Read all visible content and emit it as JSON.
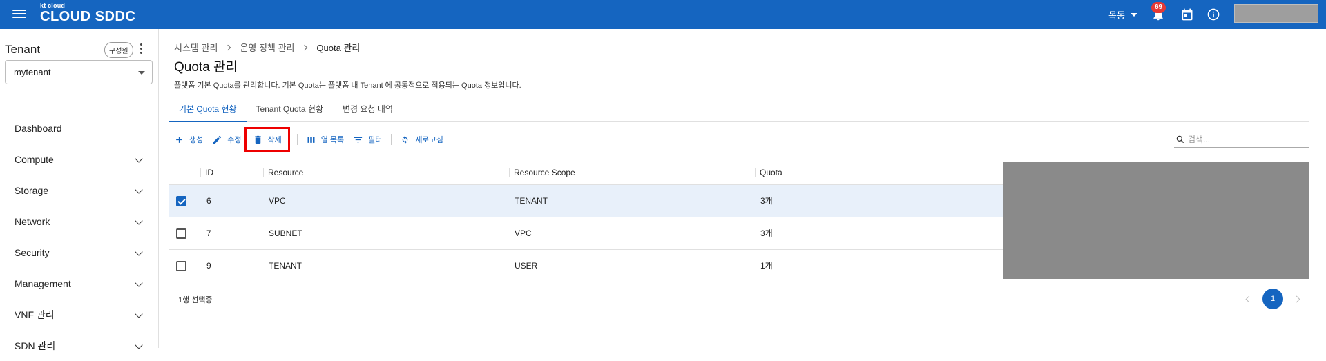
{
  "app": {
    "logo_small": "kt cloud",
    "logo_main": "CLOUD SDDC"
  },
  "topbar": {
    "user_name": "목동",
    "notification_count": "69",
    "colors": {
      "bar": "#1565c0",
      "badge": "#e53935"
    }
  },
  "sidebar": {
    "tenant_label": "Tenant",
    "role_chip": "구성원",
    "tenant_selected": "mytenant",
    "items": [
      {
        "label": "Dashboard"
      },
      {
        "label": "Compute"
      },
      {
        "label": "Storage"
      },
      {
        "label": "Network"
      },
      {
        "label": "Security"
      },
      {
        "label": "Management"
      },
      {
        "label": "VNF 관리"
      },
      {
        "label": "SDN 관리"
      }
    ]
  },
  "breadcrumb": [
    "시스템 관리",
    "운영 정책 관리",
    "Quota 관리"
  ],
  "page": {
    "title": "Quota 관리",
    "description": "플랫폼 기본 Quota를 관리합니다. 기본 Quota는 플랫폼 내 Tenant 에 공통적으로 적용되는 Quota 정보입니다."
  },
  "tabs": [
    {
      "label": "기본 Quota 현황",
      "active": true
    },
    {
      "label": "Tenant Quota 현황",
      "active": false
    },
    {
      "label": "변경 요청 내역",
      "active": false
    }
  ],
  "toolbar": {
    "create": "생성",
    "edit": "수정",
    "delete": "삭제",
    "columns": "열 목록",
    "filter": "필터",
    "refresh": "새로고침"
  },
  "search": {
    "placeholder": "검색..."
  },
  "table": {
    "headers": [
      "ID",
      "Resource",
      "Resource Scope",
      "Quota"
    ],
    "rows": [
      {
        "id": "6",
        "resource": "VPC",
        "scope": "TENANT",
        "quota": "3개",
        "selected": true
      },
      {
        "id": "7",
        "resource": "SUBNET",
        "scope": "VPC",
        "quota": "3개",
        "selected": false
      },
      {
        "id": "9",
        "resource": "TENANT",
        "scope": "USER",
        "quota": "1개",
        "selected": false
      }
    ]
  },
  "footer": {
    "selection_text": "1행 선택중",
    "current_page": "1"
  }
}
